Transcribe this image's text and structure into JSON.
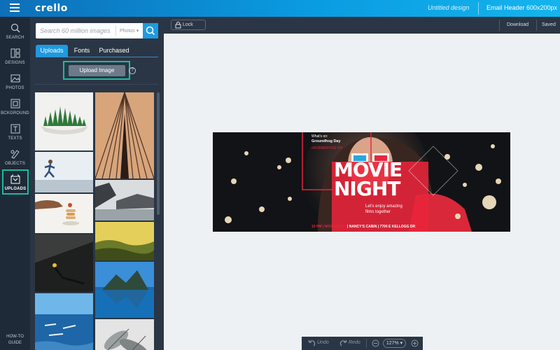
{
  "app": {
    "brand": "crello",
    "design_title": "Untitled design",
    "format": "Email Header 600x200px"
  },
  "rail": {
    "items": [
      {
        "label": "SEARCH"
      },
      {
        "label": "DESIGNS"
      },
      {
        "label": "PHOTOS"
      },
      {
        "label": "BCKGROUND"
      },
      {
        "label": "TEXTS"
      },
      {
        "label": "OBJECTS"
      },
      {
        "label": "UPLOADS",
        "active": true
      }
    ],
    "howto_line1": "HOW-TO",
    "howto_line2": "GUIDE"
  },
  "panel": {
    "search_placeholder": "Search 60 million images",
    "search_filter": "Photos",
    "tabs": [
      {
        "label": "Uploads",
        "active": true
      },
      {
        "label": "Fonts"
      },
      {
        "label": "Purchased"
      }
    ],
    "upload_button": "Upload Image",
    "help": "?"
  },
  "toolbar": {
    "lock": "Lock",
    "download": "Download",
    "saved": "Saved"
  },
  "banner": {
    "whats_on": "What's on:",
    "event": "Groundhog Day",
    "hashtag": "#ROBBERYSIS CH",
    "headline1": "MOVIE",
    "headline2": "NIGHT",
    "tagline1": "Let's enjoy amazing",
    "tagline2": "films together",
    "footer_time": "10 PM | NOVEMBER 5",
    "footer_place": "| NANCY'S CABIN | 7700 E KELLOGG DR"
  },
  "bottom": {
    "undo": "Undo",
    "redo": "Redo",
    "zoom": "127%"
  },
  "colors": {
    "accent": "#1f9ae0",
    "highlight": "#1bbba0",
    "banner_red": "#e8243a"
  }
}
